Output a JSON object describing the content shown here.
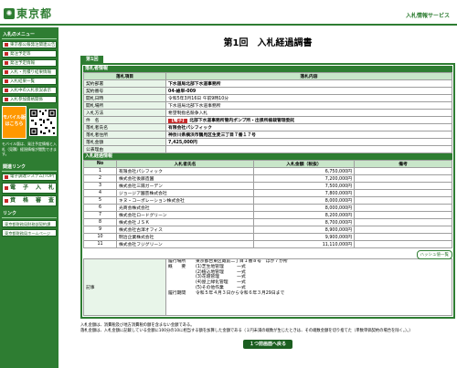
{
  "header": {
    "logo_text": "東京都",
    "service_name": "入札情報サービス"
  },
  "sidebar": {
    "menu_heading": "入札のメニュー",
    "menu_items": [
      "東京都公報発注関連公告",
      "発注予定等",
      "発注予定情報",
      "入札・見積り結果情報",
      "入札結果一覧",
      "入札中の入札状況表示",
      "入札参加資格関係"
    ],
    "mobile_label": "モバイル版",
    "mobile_sub": "はこちら",
    "mobile_note": "モバイル版は、発注予定情報と入札（見積）経過情報が閲覧できます。",
    "links_heading": "関連リンク",
    "system_link": "電子調達システム(TOP)",
    "big_buttons": [
      "電　子　入　札",
      "資　格　審　査"
    ],
    "links_heading2": "リンク",
    "footer_links": [
      "東京都財務局財務部契約課",
      "東京都財務局ホームページ"
    ]
  },
  "main": {
    "title": "第1回　入札経過調書",
    "round_tab": "第1回",
    "info_section": "落札者情報",
    "info_header_key": "落札項目",
    "info_header_value": "落札内容",
    "info_rows": [
      {
        "key": "契約部署",
        "value": "下水道局北部下水道事務所",
        "bold": true
      },
      {
        "key": "契約番号",
        "value": "04-維単-009",
        "bold": true
      },
      {
        "key": "開札日時",
        "value": "令和5年3月16日 午前9時10分",
        "bold": false
      },
      {
        "key": "開札場所",
        "value": "下水道局北部下水道事務所",
        "bold": false
      },
      {
        "key": "入札方法",
        "value": "希望制指名競争入札",
        "bold": false
      },
      {
        "key": "件　名",
        "value": "北部下水道事務所管内ポンプ所・出張所植栽管理委託",
        "tag": "【電子】",
        "bold": true
      },
      {
        "key": "落札者氏名",
        "value": "有限会社パシフィック",
        "bold": true
      },
      {
        "key": "落札者住所",
        "value": "神奈川県横浜市鶴見区生麦三丁目７番１７号",
        "bold": true
      },
      {
        "key": "落札金額",
        "value": "7,425,000円",
        "bold": true
      },
      {
        "key": "公表理由",
        "value": "",
        "bold": false
      }
    ],
    "bidders_section": "入札経過情報",
    "bidder_headers": [
      "No",
      "入札者氏名",
      "入札金額（税抜）",
      "備考"
    ],
    "bidders": [
      {
        "no": "1",
        "name": "有限会社パシフィック",
        "amount": "6,750,000円",
        "note": ""
      },
      {
        "no": "2",
        "name": "株式会社後藤造園",
        "amount": "7,200,000円",
        "note": ""
      },
      {
        "no": "3",
        "name": "株式会社三陽ガーデン",
        "amount": "7,500,000円",
        "note": ""
      },
      {
        "no": "4",
        "name": "ジョージア園芸株式会社",
        "amount": "7,800,000円",
        "note": ""
      },
      {
        "no": "5",
        "name": "キヌ・コーポレーション株式会社",
        "amount": "8,000,000円",
        "note": ""
      },
      {
        "no": "6",
        "name": "光商会株式会社",
        "amount": "8,000,000円",
        "note": ""
      },
      {
        "no": "7",
        "name": "株式会社ロードグリーン",
        "amount": "8,200,000円",
        "note": ""
      },
      {
        "no": "8",
        "name": "株式会社ＪＳＫ",
        "amount": "8,700,000円",
        "note": ""
      },
      {
        "no": "9",
        "name": "株式会社古澤オフィス",
        "amount": "8,900,000円",
        "note": ""
      },
      {
        "no": "10",
        "name": "明治企業株式会社",
        "amount": "9,900,000円",
        "note": ""
      },
      {
        "no": "11",
        "name": "株式会社フジグリーン",
        "amount": "11,110,000円",
        "note": ""
      }
    ],
    "list_button": "ハッシュ値一覧",
    "remarks_key": "記事",
    "remarks_lines": [
      {
        "label": "履行場所",
        "text": "東京都台東区蔵前二丁目１番８号　ほか７か所"
      },
      {
        "label": "概　　要",
        "text": "(1)芝生地管理　　　一式"
      },
      {
        "label": "",
        "text": "(2)植込地管理　　　一式"
      },
      {
        "label": "",
        "text": "(3)花壇管理　　　　一式"
      },
      {
        "label": "",
        "text": "(4)屋上緑化管理　　一式"
      },
      {
        "label": "",
        "text": "(5)その他作業　　　一式"
      },
      {
        "label": "履行期間",
        "text": "令和５年４月３日から令和６年３月29日まで"
      }
    ],
    "note_1": "入札金額は、消費税及び地方消費税の額を含まない金額である。",
    "note_2": "落札金額は、入札金額に記載している金額に100分の10に相当する額を加算した金額である（１円未満の端数が生じたときは、その端数金額を切り捨てた（単数単価契約の場合を除く。）。）",
    "back_button": "１つ前画面へ戻る"
  }
}
